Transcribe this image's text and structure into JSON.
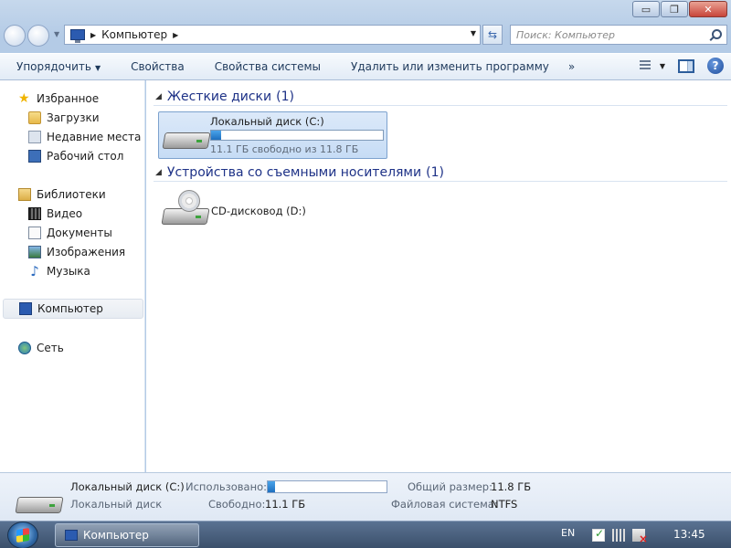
{
  "window": {
    "caption": {
      "minimize": "▭",
      "maximize": "❐",
      "close": "✕"
    }
  },
  "address_bar": {
    "path": "Компьютер",
    "search_placeholder": "Поиск: Компьютер"
  },
  "toolbar": {
    "organize": "Упорядочить",
    "properties": "Свойства",
    "system_properties": "Свойства системы",
    "uninstall": "Удалить или изменить программу",
    "more": "»"
  },
  "sidebar": {
    "favorites": "Избранное",
    "downloads": "Загрузки",
    "recent": "Недавние места",
    "desktop": "Рабочий стол",
    "libraries": "Библиотеки",
    "video": "Видео",
    "documents": "Документы",
    "images": "Изображения",
    "music": "Музыка",
    "computer": "Компьютер",
    "network": "Сеть"
  },
  "groups": {
    "hdd": {
      "title": "Жесткие диски",
      "count": "(1)"
    },
    "removable": {
      "title": "Устройства со съемными носителями",
      "count": "(1)"
    }
  },
  "drives": {
    "c": {
      "name": "Локальный диск (C:)",
      "free_text": "11.1 ГБ свободно из 11.8 ГБ",
      "used_fraction": 0.06
    },
    "d": {
      "name": "CD-дисковод (D:)"
    }
  },
  "details": {
    "name": "Локальный диск (C:)",
    "type": "Локальный диск",
    "used_label": "Использовано:",
    "free_label": "Свободно:",
    "free_value": "11.1 ГБ",
    "total_label": "Общий размер:",
    "total_value": "11.8 ГБ",
    "fs_label": "Файловая система:",
    "fs_value": "NTFS",
    "used_fraction": 0.06
  },
  "taskbar": {
    "task": "Компьютер",
    "lang": "EN",
    "time": "13:45"
  }
}
